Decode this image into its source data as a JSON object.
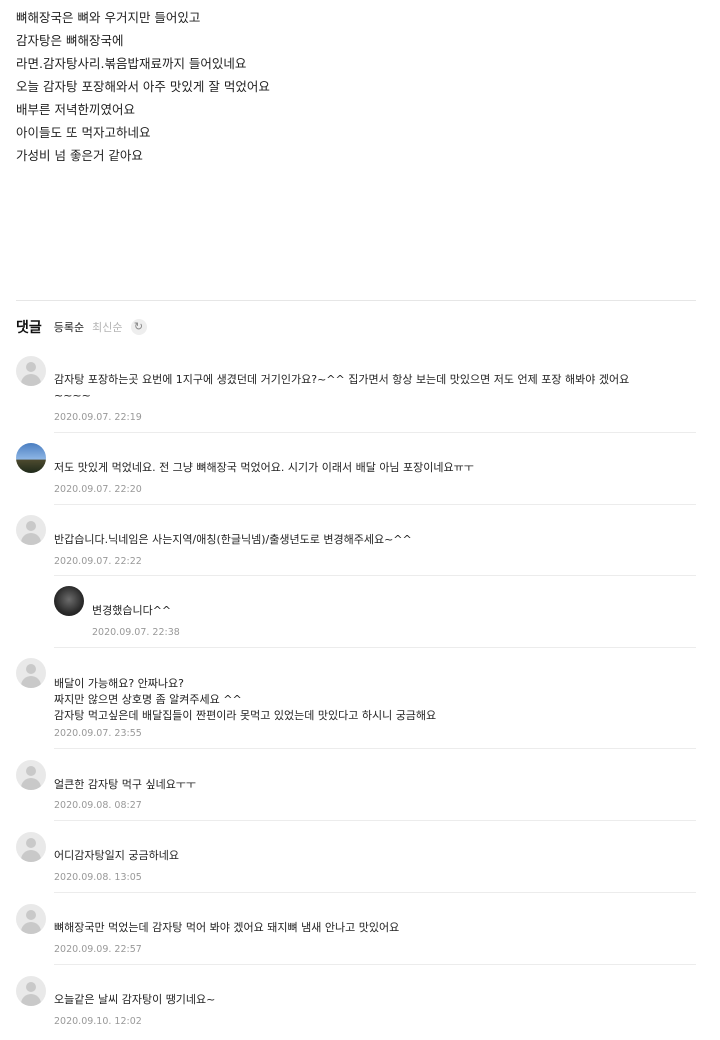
{
  "post": {
    "lines": [
      "뼈해장국은 뼈와 우거지만 들어있고",
      "감자탕은 뼈해장국에",
      "라면.감자탕사리.볶음밥재료까지 들어있네요",
      "오늘 감자탕 포장해와서 아주 맛있게 잘 먹었어요",
      "배부른 저녁한끼였어요",
      "아이들도 또 먹자고하네요",
      "가성비 넘 좋은거 같아요"
    ]
  },
  "comments_header": {
    "title": "댓글",
    "sort_registered": "등록순",
    "sort_latest": "최신순",
    "refresh_icon": "refresh-icon"
  },
  "comments": [
    {
      "text": "감자탕 포장하는곳 요번에 1지구에 생겼던데 거기인가요?~^^ 집가면서 항상 보는데 맛있으면 저도 언제 포장 해봐야 겠어요\n~~~~",
      "date": "2020.09.07. 22:19",
      "avatar": "default-avatar"
    },
    {
      "text": "저도 맛있게 먹었네요. 전 그냥 뼈해장국 먹었어요. 시기가 이래서 배달 아님 포장이네요ㅠㅜ",
      "date": "2020.09.07. 22:20",
      "avatar": "landscape-photo-avatar"
    },
    {
      "text": "반갑습니다.닉네임은 사는지역/애칭(한글닉넴)/출생년도로 변경해주세요~^^",
      "date": "2020.09.07. 22:22",
      "avatar": "default-avatar"
    },
    {
      "text": "변경했습니다^^",
      "date": "2020.09.07. 22:38",
      "avatar": "dark-photo-avatar",
      "reply": true
    },
    {
      "text": "배달이 가능해요? 안짜나요?\n짜지만 않으면 상호명 좀 알켜주세요 ^^\n감자탕 먹고싶은데 배달집들이 짠편이라 못먹고 있었는데 맛있다고 하시니 궁금해요",
      "date": "2020.09.07. 23:55",
      "avatar": "default-avatar"
    },
    {
      "text": "얼큰한 감자탕 먹구 싶네요ㅜㅜ",
      "date": "2020.09.08. 08:27",
      "avatar": "default-avatar"
    },
    {
      "text": "어디감자탕일지 궁금하네요",
      "date": "2020.09.08. 13:05",
      "avatar": "default-avatar"
    },
    {
      "text": "뼈해장국만 먹었는데 감자탕 먹어 봐야 겠어요 돼지뼈 냄새 안나고 맛있어요",
      "date": "2020.09.09. 22:57",
      "avatar": "default-avatar"
    },
    {
      "text": "오늘같은 날씨 감자탕이 땡기네요~",
      "date": "2020.09.10. 12:02",
      "avatar": "default-avatar"
    }
  ]
}
